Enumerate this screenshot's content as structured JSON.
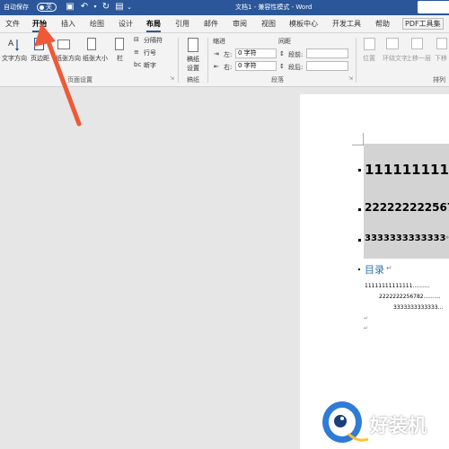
{
  "titlebar": {
    "autosave_label": "自动保存",
    "autosave_state": "关",
    "doc_title": "文档1  -  兼容性模式  -  Word"
  },
  "tabs": [
    "文件",
    "开始",
    "插入",
    "绘图",
    "设计",
    "布局",
    "引用",
    "邮件",
    "审阅",
    "视图",
    "模板中心",
    "开发工具",
    "帮助",
    "PDF工具集"
  ],
  "ribbon": {
    "text_direction": "文字方向",
    "margins": "页边距",
    "orientation": "纸张方向",
    "size": "纸张大小",
    "columns": "栏",
    "breaks": "分隔符",
    "line_numbers": "行号",
    "hyphenation": "断字",
    "manuscript": "稿纸",
    "manuscript_settings": "设置",
    "page_setup_label": "页面设置",
    "manuscript_label": "稿纸",
    "indent": "缩进",
    "spacing": "间距",
    "left": "左:",
    "right": "右:",
    "before": "段前:",
    "after": "段后:",
    "left_value": "0 字符",
    "right_value": "0 字符",
    "paragraph_label": "段落",
    "position": "位置",
    "wrap_text": "环绕文字",
    "bring_forward": "上移一层",
    "send_backward": "下移",
    "arrange_label": "排列"
  },
  "document": {
    "heading1": "11111111111",
    "heading2": "22222222256782",
    "heading3": "3333333333333",
    "toc_title": "目录",
    "toc1": "11111111111111..........",
    "toc2": "2222222256782..........",
    "toc3": "3333333333333..."
  },
  "watermark": "好装机"
}
